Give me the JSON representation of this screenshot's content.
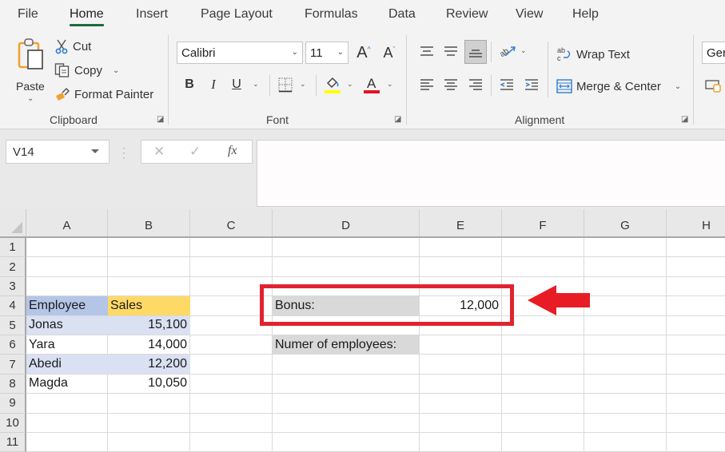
{
  "menu": {
    "tabs": [
      {
        "label": "File",
        "active": false
      },
      {
        "label": "Home",
        "active": true
      },
      {
        "label": "Insert",
        "active": false
      },
      {
        "label": "Page Layout",
        "active": false
      },
      {
        "label": "Formulas",
        "active": false
      },
      {
        "label": "Data",
        "active": false
      },
      {
        "label": "Review",
        "active": false
      },
      {
        "label": "View",
        "active": false
      },
      {
        "label": "Help",
        "active": false
      }
    ]
  },
  "ribbon": {
    "clipboard": {
      "paste": "Paste",
      "cut": "Cut",
      "copy": "Copy",
      "format_painter": "Format Painter",
      "group_label": "Clipboard"
    },
    "font": {
      "font_name": "Calibri",
      "font_size": "11",
      "bold": "B",
      "italic": "I",
      "underline": "U",
      "group_label": "Font",
      "highlight_color": "#ffff00",
      "font_color": "#e81123"
    },
    "alignment": {
      "wrap_text": "Wrap Text",
      "merge_center": "Merge & Center",
      "group_label": "Alignment"
    },
    "number": {
      "format": "Ger"
    }
  },
  "formula_bar": {
    "name_box": "V14",
    "cancel": "✕",
    "enter": "✓",
    "fx": "fx",
    "formula": ""
  },
  "sheet": {
    "columns": [
      "A",
      "B",
      "C",
      "D",
      "E",
      "F",
      "G",
      "H"
    ],
    "rows": [
      "1",
      "2",
      "3",
      "4",
      "5",
      "6",
      "7",
      "8",
      "9",
      "10",
      "11"
    ],
    "cells": {
      "A4": "Employee",
      "B4": "Sales",
      "A5": "Jonas",
      "B5": "15,100",
      "A6": "Yara",
      "B6": "14,000",
      "A7": "Abedi",
      "B7": "12,200",
      "A8": "Magda",
      "B8": "10,050",
      "D4": "Bonus:",
      "E4": "12,000",
      "D6": "Numer of employees:",
      "E6": ""
    },
    "colors": {
      "employee_header": "#b4c6e7",
      "sales_header": "#ffd966",
      "band_row": "#d9e1f2",
      "label_gray": "#d9d9d9",
      "annotation_red": "#e0232e"
    }
  }
}
